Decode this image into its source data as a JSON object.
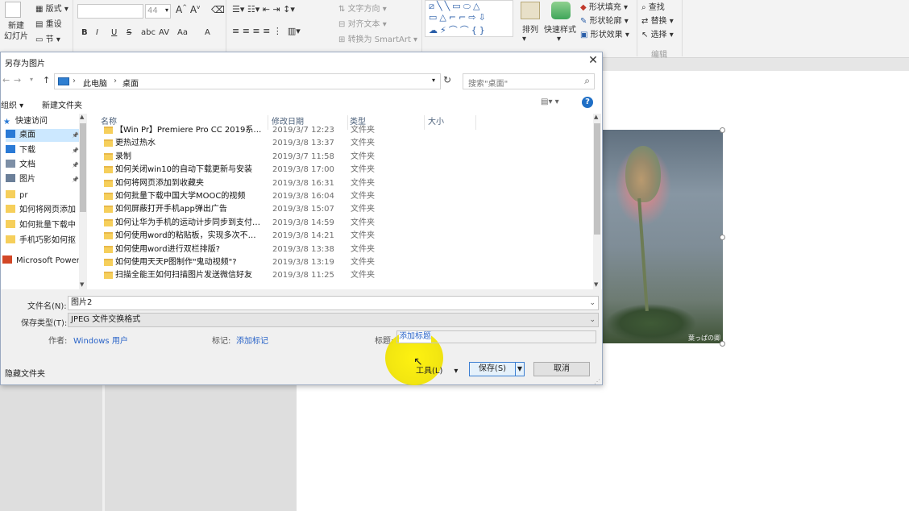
{
  "ribbon": {
    "layout_label": "版式",
    "reset_label": "重设",
    "new_slide_label": "新建\n幻灯片",
    "section_label": "节",
    "font_size": "44",
    "text_direction": "文字方向",
    "align_text": "对齐文本",
    "convert_smartart": "转换为 SmartArt",
    "arrange_label": "排列",
    "quick_styles": "快速样式",
    "shape_fill": "形状填充",
    "shape_outline": "形状轮廓",
    "shape_effects": "形状效果",
    "find_label": "查找",
    "replace_label": "替换",
    "select_label": "选择",
    "editing_group": "编辑",
    "font_buttons": [
      "B",
      "I",
      "U",
      "S",
      "abc",
      "AV",
      "Aa",
      "A"
    ]
  },
  "dialog": {
    "title": "另存为图片",
    "breadcrumb": [
      "此电脑",
      "桌面"
    ],
    "search_placeholder": "搜索\"桌面\"",
    "organize": "组织",
    "new_folder": "新建文件夹",
    "nav": [
      {
        "label": "快速访问",
        "icon": "star-icon"
      },
      {
        "label": "桌面",
        "icon": "desktop-icon"
      },
      {
        "label": "下载",
        "icon": "download-icon"
      },
      {
        "label": "文档",
        "icon": "document-icon"
      },
      {
        "label": "图片",
        "icon": "picture-icon"
      },
      {
        "label": "pr",
        "icon": "folder-icon"
      },
      {
        "label": "如何将网页添加",
        "icon": "folder-icon"
      },
      {
        "label": "如何批量下载中",
        "icon": "folder-icon"
      },
      {
        "label": "手机巧影如何抠",
        "icon": "folder-icon"
      },
      {
        "label": "Microsoft Power",
        "icon": "powerpoint-icon"
      }
    ],
    "columns": [
      "名称",
      "修改日期",
      "类型",
      "大小"
    ],
    "files": [
      {
        "name": "【Win Pr】Premiere Pro CC 2019系统...",
        "date": "2019/3/7 12:23",
        "type": "文件夹"
      },
      {
        "name": "更热过热水",
        "date": "2019/3/8 13:37",
        "type": "文件夹"
      },
      {
        "name": "录制",
        "date": "2019/3/7 11:58",
        "type": "文件夹"
      },
      {
        "name": "如何关闭win10的自动下载更新与安装",
        "date": "2019/3/8 17:00",
        "type": "文件夹"
      },
      {
        "name": "如何将网页添加到收藏夹",
        "date": "2019/3/8 16:31",
        "type": "文件夹"
      },
      {
        "name": "如何批量下载中国大学MOOC的视频",
        "date": "2019/3/8 16:04",
        "type": "文件夹"
      },
      {
        "name": "如何屏蔽打开手机app弹出广告",
        "date": "2019/3/8 15:07",
        "type": "文件夹"
      },
      {
        "name": "如何让华为手机的运动计步同步到支付宝...",
        "date": "2019/3/8 14:59",
        "type": "文件夹"
      },
      {
        "name": "如何使用word的粘贴板，实现多次不同...",
        "date": "2019/3/8 14:21",
        "type": "文件夹"
      },
      {
        "name": "如何使用word进行双栏排版?",
        "date": "2019/3/8 13:38",
        "type": "文件夹"
      },
      {
        "name": "如何使用天天P图制作\"鬼动视频\"?",
        "date": "2019/3/8 13:19",
        "type": "文件夹"
      },
      {
        "name": "扫描全能王如何扫描图片发送微信好友",
        "date": "2019/3/8 11:25",
        "type": "文件夹"
      }
    ],
    "filename_label": "文件名(N):",
    "filename_value": "图片2",
    "savetype_label": "保存类型(T):",
    "savetype_value": "JPEG 文件交换格式",
    "author_label": "作者:",
    "author_value": "Windows 用户",
    "tags_label": "标记:",
    "tags_value": "添加标记",
    "title_label": "标题:",
    "title_value": "添加标题",
    "hide_folders": "隐藏文件夹",
    "tools_label": "工具(L)",
    "save_label": "保存(S)",
    "cancel_label": "取消"
  },
  "slide": {
    "watermark": "葉っぱの卿"
  }
}
